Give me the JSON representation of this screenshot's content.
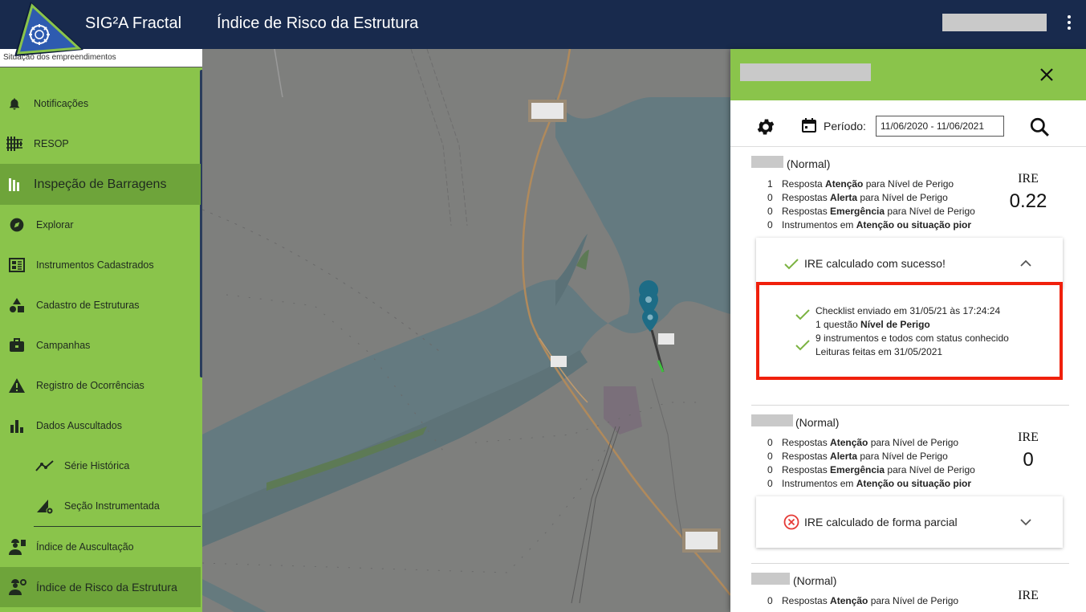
{
  "header": {
    "app_name": "SIG²A Fractal",
    "page_title": "Índice de Risco da Estrutura"
  },
  "sidebar": {
    "caption": "Situação dos empreendimentos",
    "items": [
      {
        "label": "Notificações",
        "icon": "bell-icon"
      },
      {
        "label": "RESOP",
        "icon": "resop-icon"
      },
      {
        "label": "Inspeção de Barragens",
        "icon": "dam-icon"
      },
      {
        "label": "Explorar",
        "icon": "compass-icon"
      },
      {
        "label": "Instrumentos Cadastrados",
        "icon": "instruments-icon"
      },
      {
        "label": "Cadastro de Estruturas",
        "icon": "shapes-icon"
      },
      {
        "label": "Campanhas",
        "icon": "briefcase-icon"
      },
      {
        "label": "Registro de Ocorrências",
        "icon": "warning-icon"
      },
      {
        "label": "Dados Auscultados",
        "icon": "bar-chart-icon"
      },
      {
        "label": "Série Histórica",
        "icon": "trend-icon"
      },
      {
        "label": "Seção Instrumentada",
        "icon": "section-gear-icon"
      },
      {
        "label": "Índice de Auscultação",
        "icon": "engineer-icon"
      },
      {
        "label": "Índice de Risco da Estrutura",
        "icon": "engineer-gear-icon"
      }
    ]
  },
  "panel": {
    "period_label": "Período:",
    "period_value": "11/06/2020 - 11/06/2021",
    "cards": [
      {
        "status": "(Normal)",
        "rows": [
          {
            "num": "1",
            "pre": "Resposta ",
            "bold": "Atenção",
            "post": " para Nível de Perigo"
          },
          {
            "num": "0",
            "pre": "Respostas ",
            "bold": "Alerta",
            "post": " para Nível de Perigo"
          },
          {
            "num": "0",
            "pre": "Respostas ",
            "bold": "Emergência",
            "post": " para Nível de Perigo"
          },
          {
            "num": "0",
            "pre": "Instrumentos em ",
            "bold": "Atenção ou situação pior",
            "post": ""
          }
        ],
        "ire_label": "IRE",
        "ire_value": "0.22",
        "accordion": "IRE calculado com sucesso!",
        "details": {
          "line1": "Checklist enviado em 31/05/21 às 17:24:24",
          "line2_pre": "1 questão ",
          "line2_bold": "Nível de Perigo",
          "line3": "9 instrumentos e todos com status conhecido",
          "line4": "Leituras feitas em 31/05/2021"
        }
      },
      {
        "status": "(Normal)",
        "rows": [
          {
            "num": "0",
            "pre": "Respostas ",
            "bold": "Atenção",
            "post": " para Nível de Perigo"
          },
          {
            "num": "0",
            "pre": "Respostas ",
            "bold": "Alerta",
            "post": " para Nível de Perigo"
          },
          {
            "num": "0",
            "pre": "Respostas ",
            "bold": "Emergência",
            "post": " para Nível de Perigo"
          },
          {
            "num": "0",
            "pre": "Instrumentos em ",
            "bold": "Atenção ou situação pior",
            "post": ""
          }
        ],
        "ire_label": "IRE",
        "ire_value": "0",
        "accordion": "IRE calculado de forma parcial"
      },
      {
        "status": "(Normal)",
        "rows": [
          {
            "num": "0",
            "pre": "Respostas ",
            "bold": "Atenção",
            "post": " para Nível de Perigo"
          }
        ],
        "ire_label": "IRE"
      }
    ]
  },
  "colors": {
    "topbar": "#182a4d",
    "sidebar_green": "#8ac44b",
    "sidebar_active": "#6ea43a",
    "highlight_border": "#f0200c",
    "check_green": "#7cb342",
    "error_red": "#e53935"
  }
}
